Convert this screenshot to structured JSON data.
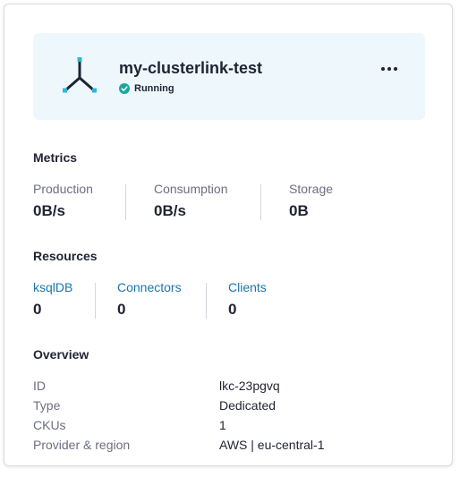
{
  "cluster": {
    "name": "my-clusterlink-test",
    "status": "Running",
    "status_color": "#17a7a0",
    "icon": "cluster-link-icon",
    "accent_color": "#30b7d6"
  },
  "metrics": {
    "title": "Metrics",
    "items": [
      {
        "label": "Production",
        "value": "0B/s"
      },
      {
        "label": "Consumption",
        "value": "0B/s"
      },
      {
        "label": "Storage",
        "value": "0B"
      }
    ]
  },
  "resources": {
    "title": "Resources",
    "items": [
      {
        "label": "ksqlDB",
        "value": "0"
      },
      {
        "label": "Connectors",
        "value": "0"
      },
      {
        "label": "Clients",
        "value": "0"
      }
    ]
  },
  "overview": {
    "title": "Overview",
    "rows": [
      {
        "key": "ID",
        "value": "lkc-23pgvq"
      },
      {
        "key": "Type",
        "value": "Dedicated"
      },
      {
        "key": "CKUs",
        "value": "1"
      },
      {
        "key": "Provider & region",
        "value": "AWS | eu-central-1"
      }
    ]
  }
}
